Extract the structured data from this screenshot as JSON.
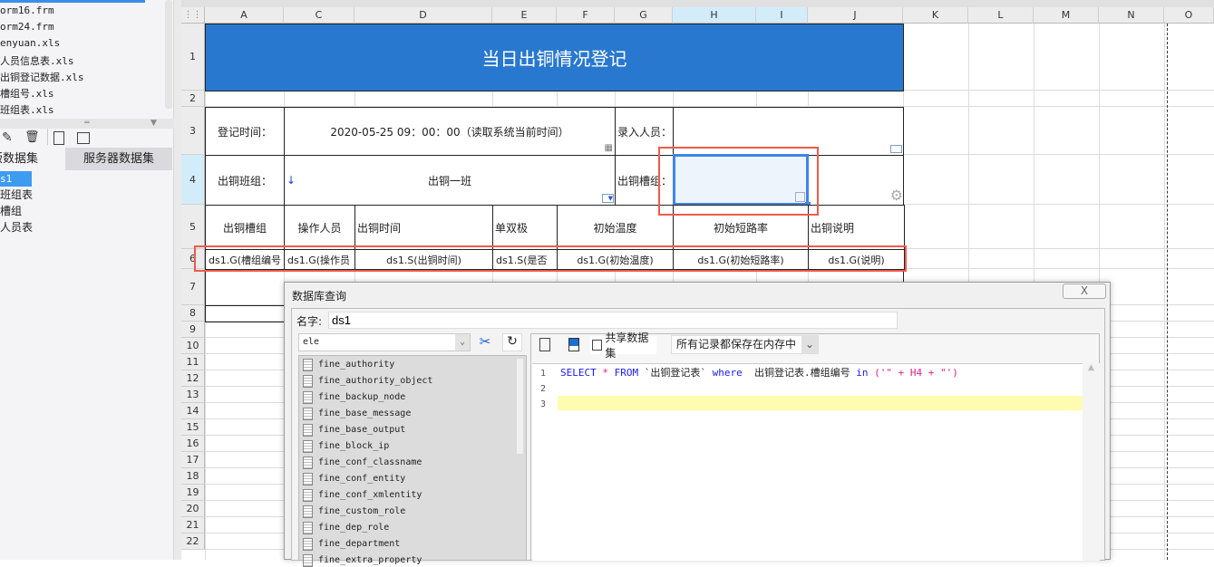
{
  "sidebar": {
    "files": [
      "orm16.frm",
      "orm24.frm",
      "enyuan.xls",
      "人员信息表.xls",
      "出铜登记数据.xls",
      "槽组号.xls",
      "班组表.xls"
    ],
    "tabs": [
      "版数据集",
      "服务器数据集"
    ],
    "datasets": [
      "s1",
      "班组表",
      "槽组",
      "人员表"
    ],
    "toolbar_icons": [
      "edit-icon",
      "delete-icon",
      "preview-icon",
      "edit-dataset-icon"
    ]
  },
  "sheet": {
    "columns": [
      "A",
      "C",
      "D",
      "E",
      "F",
      "G",
      "H",
      "I",
      "J",
      "K",
      "L",
      "M",
      "N",
      "O"
    ],
    "rows": [
      "1",
      "2",
      "3",
      "4",
      "5",
      "6",
      "7",
      "8",
      "9",
      "10",
      "11",
      "12",
      "13",
      "14",
      "15",
      "16",
      "17",
      "18",
      "19",
      "20",
      "21",
      "22"
    ],
    "title": "当日出铜情况登记",
    "r3": {
      "label": "登记时间：",
      "value": "2020-05-25 09：00：00（读取系统当前时间）",
      "label2": "录入人员："
    },
    "r4": {
      "label": "出铜班组：",
      "value": "出铜一班",
      "label2": "出铜槽组："
    },
    "headers": [
      "出铜槽组",
      "操作人员",
      "出铜时间",
      "单双极",
      "初始温度",
      "初始短路率",
      "出铜说明"
    ],
    "bindings": [
      "ds1.G(槽组编号",
      "ds1.G(操作员",
      "ds1.S(出铜时间)",
      "ds1.S(是否",
      "ds1.G(初始温度)",
      "ds1.G(初始短路率)",
      "ds1.G(说明)"
    ],
    "accent": "#2878d0"
  },
  "dialog": {
    "title": "数据库查询",
    "close": "X",
    "name_label": "名字:",
    "name_value": "ds1",
    "schema_value": "ele",
    "tables": [
      "fine_authority",
      "fine_authority_object",
      "fine_backup_node",
      "fine_base_message",
      "fine_base_output",
      "fine_block_ip",
      "fine_conf_classname",
      "fine_conf_entity",
      "fine_conf_xmlentity",
      "fine_custom_role",
      "fine_dep_role",
      "fine_department",
      "fine_extra_property"
    ],
    "share_label": "共享数据集",
    "share_checked": false,
    "memory_option": "所有记录都保存在内存中",
    "sql": {
      "kw1": "SELECT",
      "star": " * ",
      "kw2": "FROM",
      "t1": " `出铜登记表` ",
      "kw3": "where",
      "t2": "  出铜登记表.槽组编号 ",
      "kw4": "in",
      "s1": " ('\" + H4 + \"')"
    },
    "line_numbers": [
      "1",
      "2",
      "3"
    ]
  }
}
